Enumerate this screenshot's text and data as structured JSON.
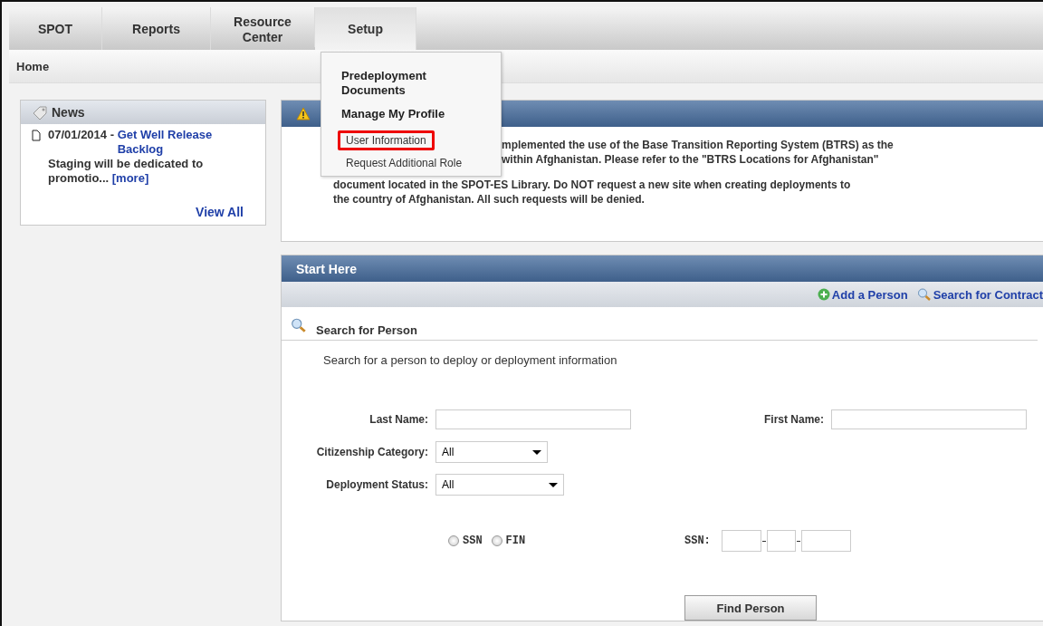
{
  "nav": {
    "tabs": [
      {
        "label": "SPOT",
        "selected": false
      },
      {
        "label": "Reports",
        "selected": false
      },
      {
        "label": "Resource Center",
        "selected": false,
        "kind": "two-line"
      },
      {
        "label": "Setup",
        "selected": true
      }
    ]
  },
  "breadcrumb": "Home",
  "setup_menu": {
    "items": [
      {
        "label": "Predeployment Documents",
        "kind": "heading",
        "selected": false
      },
      {
        "label": "Manage My Profile",
        "kind": "heading",
        "selected": false
      },
      {
        "label": "User Information",
        "kind": "link",
        "selected": true
      },
      {
        "label": "Request Additional Role",
        "kind": "link",
        "selected": false
      }
    ]
  },
  "news": {
    "title": "News",
    "items": [
      {
        "date": "07/01/2014 - ",
        "title": "Get Well Release Backlog",
        "summary": "Staging will be dedicated to promotio...",
        "more": "[more]"
      }
    ],
    "view_all": "View All"
  },
  "alert": {
    "lines_beside_menu": [
      "mplemented the use of the Base Transition Reporting System (BTRS) as the",
      "within Afghanistan. Please refer to the \"BTRS Locations for Afghanistan\""
    ],
    "lines": [
      "document located in the SPOT-ES Library. Do NOT request a new site when creating deployments to",
      "the country of Afghanistan. All such requests will be denied."
    ]
  },
  "start_here": {
    "title": "Start Here",
    "actions": [
      {
        "label": "Add a Person",
        "kind": "add"
      },
      {
        "label": "Search for Contract",
        "kind": "search"
      }
    ],
    "section_title": "Search for Person",
    "description": "Search for a person to deploy or deployment information",
    "last_name": {
      "label": "Last Name:"
    },
    "first_name": {
      "label": "First Name:"
    },
    "citizenship": {
      "label": "Citizenship Category:",
      "value": "All"
    },
    "deployment_status": {
      "label": "Deployment Status:",
      "value": "All"
    },
    "id_types": [
      {
        "label": "SSN",
        "selected": false
      },
      {
        "label": "FIN",
        "selected": false
      }
    ],
    "ssn": {
      "label": "SSN:"
    },
    "find_button": "Find Person"
  }
}
